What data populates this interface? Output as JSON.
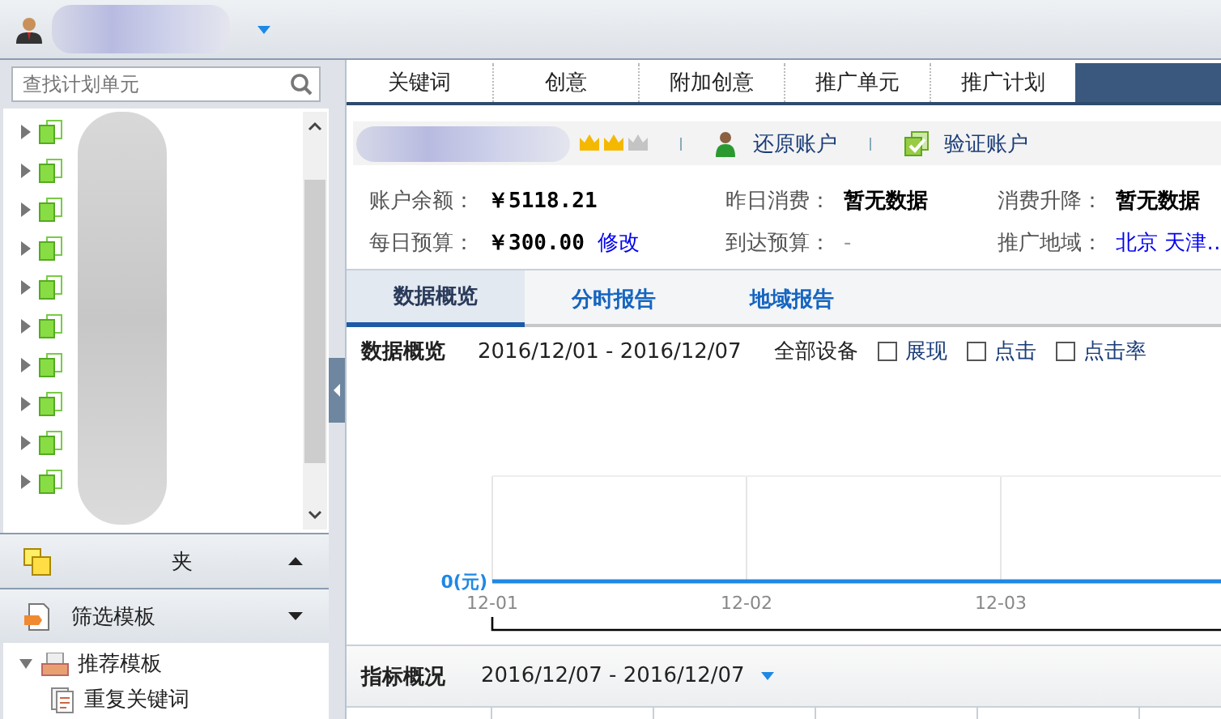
{
  "search": {
    "placeholder": "查找计划单元"
  },
  "tree": [
    {
      "expanded": false
    },
    {
      "expanded": false
    },
    {
      "expanded": false
    },
    {
      "expanded": false
    },
    {
      "expanded": false
    },
    {
      "expanded": false
    },
    {
      "expanded": false
    },
    {
      "expanded": false
    },
    {
      "expanded": false
    },
    {
      "expanded": false
    }
  ],
  "sections": [
    {
      "label": "夹",
      "expanded": true,
      "kind": "folder"
    },
    {
      "label": "筛选模板",
      "expanded": false,
      "kind": "filter"
    }
  ],
  "templates": {
    "label": "推荐模板",
    "expanded": true,
    "children": [
      {
        "label": "重复关键词"
      }
    ]
  },
  "tabs": [
    {
      "label": "关键词",
      "selected": false
    },
    {
      "label": "创意",
      "selected": false
    },
    {
      "label": "附加创意",
      "selected": false
    },
    {
      "label": "推广单元",
      "selected": false
    },
    {
      "label": "推广计划",
      "selected": false
    },
    {
      "selected": true
    }
  ],
  "account": {
    "stars": 2,
    "actions": [
      {
        "label": "还原账户",
        "kind": "restore"
      },
      {
        "label": "验证账户",
        "kind": "verify"
      }
    ]
  },
  "info": [
    {
      "label": "账户余额：",
      "value": "￥5118.21",
      "kind": "money"
    },
    {
      "label": "昨日消费：",
      "value": "暂无数据",
      "kind": "bold"
    },
    {
      "label": "消费升降：",
      "value": "暂无数据",
      "kind": "bold"
    },
    {
      "label": "每日预算：",
      "value": "￥300.00",
      "kind": "money",
      "link": "修改"
    },
    {
      "label": "到达预算：",
      "value": "-",
      "kind": "muted"
    },
    {
      "label": "推广地域：",
      "value": "北京 天津…",
      "kind": "link"
    }
  ],
  "report_tabs": [
    {
      "label": "数据概览",
      "selected": true
    },
    {
      "label": "分时报告",
      "selected": false
    },
    {
      "label": "地域报告",
      "selected": false
    }
  ],
  "overview": {
    "title": "数据概览",
    "range": "2016/12/01 - 2016/12/07",
    "device": "全部设备",
    "metrics": [
      {
        "label": "展现",
        "checked": false
      },
      {
        "label": "点击",
        "checked": false
      },
      {
        "label": "点击率",
        "checked": false
      }
    ],
    "chart": {
      "y_label": "0(元)",
      "x_labels": [
        "12-01",
        "12-02",
        "12-03"
      ]
    }
  },
  "indicators": {
    "title": "指标概况",
    "range": "2016/12/07 - 2016/12/07"
  }
}
